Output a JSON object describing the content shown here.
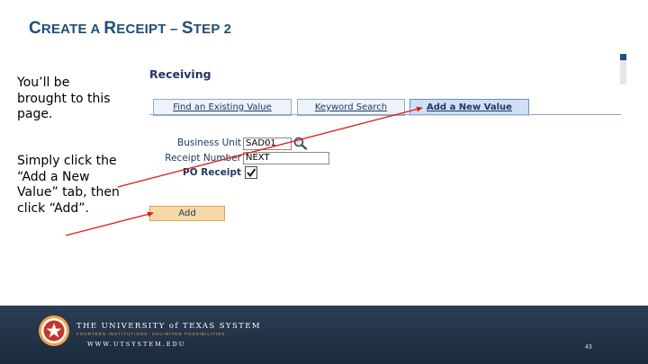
{
  "title": {
    "first_cap": "C",
    "first_rest": "REATE A ",
    "second_cap": "R",
    "second_rest": "ECEIPT – ",
    "third_cap": "S",
    "third_rest": "TEP 2"
  },
  "instructions": {
    "para1": "You’ll be brought to this page.",
    "para2": "Simply click the “Add a New Value” tab, then click “Add”."
  },
  "screen": {
    "heading": "Receiving",
    "tabs": [
      "Find an Existing Value",
      "Keyword Search",
      "Add a New Value"
    ],
    "fields": {
      "business_unit_label": "Business Unit",
      "business_unit_value": "SAD01",
      "receipt_number_label": "Receipt Number",
      "receipt_number_value": "NEXT",
      "po_receipt_label": "PO Receipt",
      "po_receipt_checked": true
    },
    "add_button": "Add"
  },
  "footer": {
    "org": "THE UNIVERSITY of TEXAS SYSTEM",
    "sub": "FOURTEEN INSTITUTIONS. UNLIMITED POSSIBILITIES.",
    "url": "WWW.UTSYSTEM.EDU",
    "page": "43"
  },
  "colors": {
    "title": "#1f4e79",
    "arrow": "#e01b1b",
    "footer_bg": "#1b2a3d",
    "footer_accent": "#f0a14a",
    "button": "#f6d9a6"
  },
  "icons": [
    "lookup-magnifier-icon",
    "checkbox-checked-icon",
    "ut-system-seal"
  ]
}
